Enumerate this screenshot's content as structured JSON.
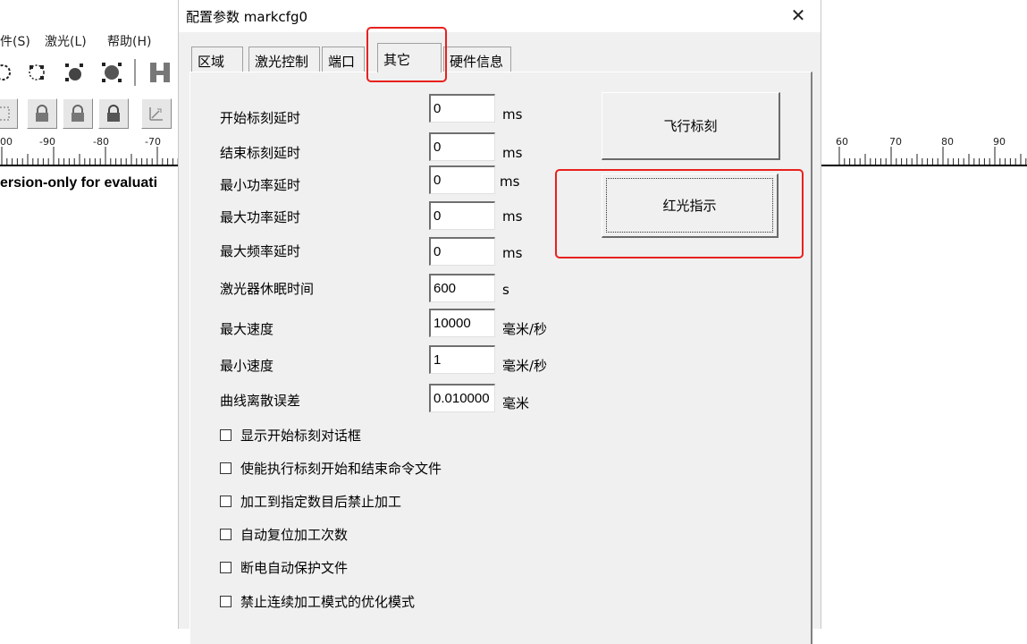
{
  "background_app": {
    "menu": [
      "件(S)",
      "激光(L)",
      "帮助(H)"
    ],
    "ruler_left_labels": [
      "00",
      "-90",
      "-80",
      "-70"
    ],
    "ruler_right_labels": [
      "60",
      "70",
      "80",
      "90"
    ],
    "eval_text": "ersion-only for evaluati"
  },
  "dialog": {
    "title": "配置参数 markcfg0",
    "close_glyph": "✕",
    "tabs": [
      {
        "label": "区域",
        "active": false
      },
      {
        "label": "激光控制",
        "active": false
      },
      {
        "label": "端口",
        "active": false
      },
      {
        "label": "其它",
        "active": true
      },
      {
        "label": "硬件信息",
        "active": false
      }
    ],
    "fields": [
      {
        "label": "开始标刻延时",
        "value": "0",
        "unit": "ms"
      },
      {
        "label": "结束标刻延时",
        "value": "0",
        "unit": "ms"
      },
      {
        "label": "最小功率延时",
        "value": "0",
        "unit": "ms"
      },
      {
        "label": "最大功率延时",
        "value": "0",
        "unit": "ms"
      },
      {
        "label": "最大频率延时",
        "value": "0",
        "unit": "ms"
      },
      {
        "label": "激光器休眠时间",
        "value": "600",
        "unit": "s"
      },
      {
        "label": "最大速度",
        "value": "10000",
        "unit": "毫米/秒"
      },
      {
        "label": "最小速度",
        "value": "1",
        "unit": "毫米/秒"
      },
      {
        "label": "曲线离散误差",
        "value": "0.010000",
        "unit": "毫米"
      }
    ],
    "checkboxes": [
      {
        "label": "显示开始标刻对话框",
        "checked": false
      },
      {
        "label": "使能执行标刻开始和结束命令文件",
        "checked": false
      },
      {
        "label": "加工到指定数目后禁止加工",
        "checked": false
      },
      {
        "label": "自动复位加工次数",
        "checked": false
      },
      {
        "label": "断电自动保护文件",
        "checked": false
      },
      {
        "label": "禁止连续加工模式的优化模式",
        "checked": false
      }
    ],
    "buttons": {
      "fly_mark": "飞行标刻",
      "red_light": "红光指示"
    }
  },
  "colors": {
    "highlight": "#e8211d",
    "dialog_bg": "#f0f0f0"
  }
}
